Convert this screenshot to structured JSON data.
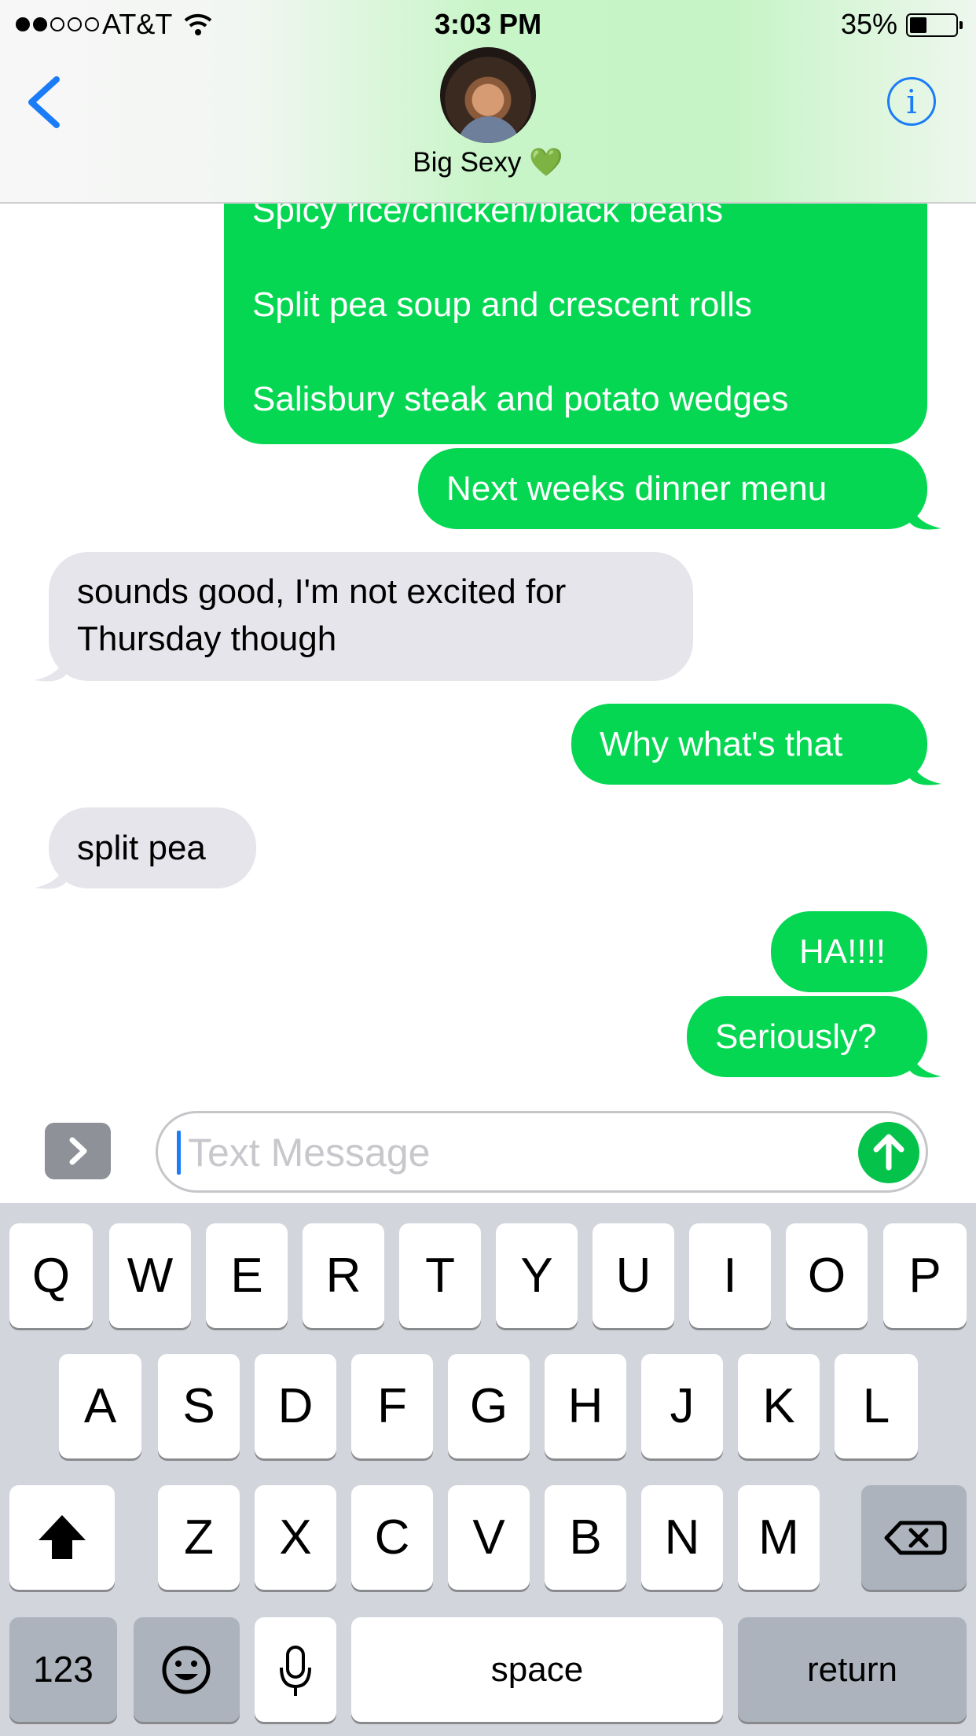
{
  "status_bar": {
    "carrier": "AT&T",
    "time": "3:03 PM",
    "battery_percent": "35%",
    "battery_level": 0.35,
    "signal_bars_filled": 2,
    "signal_bars_total": 5
  },
  "header": {
    "contact_name": "Big Sexy 💚",
    "info_label": "i"
  },
  "messages": {
    "menu_lines": [
      "Spicy rice/chicken/black beans",
      "Split pea soup and crescent rolls",
      "Salisbury steak and potato wedges"
    ],
    "m1": "Next weeks dinner menu",
    "m2_line1": "sounds good, I'm not excited for",
    "m2_line2": "Thursday though",
    "m3": "Why what's that",
    "m4": "split pea",
    "m5": "HA!!!!",
    "m6": "Seriously?"
  },
  "input": {
    "placeholder": "Text Message"
  },
  "keyboard": {
    "row1": [
      "Q",
      "W",
      "E",
      "R",
      "T",
      "Y",
      "U",
      "I",
      "O",
      "P"
    ],
    "row2": [
      "A",
      "S",
      "D",
      "F",
      "G",
      "H",
      "J",
      "K",
      "L"
    ],
    "row3": [
      "Z",
      "X",
      "C",
      "V",
      "B",
      "N",
      "M"
    ],
    "numbers": "123",
    "space": "space",
    "return": "return"
  },
  "colors": {
    "sent_bubble": "#05d752",
    "received_bubble": "#e6e5eb",
    "accent_blue": "#1a7cf6"
  },
  "icons": {
    "back": "chevron-left-icon",
    "info": "info-icon",
    "expand": "chevron-right-icon",
    "send": "arrow-up-icon",
    "shift": "shift-icon",
    "delete": "backspace-icon",
    "emoji": "emoji-icon",
    "mic": "microphone-icon"
  }
}
